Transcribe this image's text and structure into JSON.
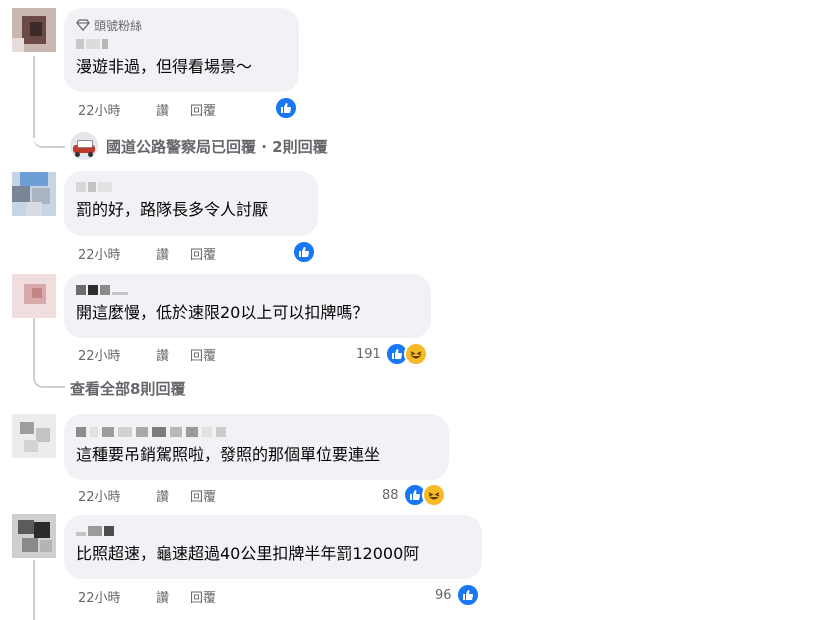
{
  "badges": {
    "top_fan": "頭號粉絲"
  },
  "actions": {
    "like": "讚",
    "reply": "回覆"
  },
  "comments": [
    {
      "text": "漫遊非過，但得看場景～",
      "time": "22小時",
      "reactions": {
        "count": "",
        "types": [
          "like"
        ]
      }
    },
    {
      "text": "罰的好，路隊長多令人討厭",
      "time": "22小時",
      "reactions": {
        "count": "",
        "types": [
          "like"
        ]
      }
    },
    {
      "text": "開這麼慢，低於速限20以上可以扣牌嗎？",
      "time": "22小時",
      "reactions": {
        "count": "191",
        "types": [
          "like",
          "haha"
        ]
      }
    },
    {
      "text": "這種要吊銷駕照啦，發照的那個單位要連坐",
      "time": "22小時",
      "reactions": {
        "count": "88",
        "types": [
          "like",
          "haha"
        ]
      }
    },
    {
      "text": "比照超速，龜速超過40公里扣牌半年罰12000阿",
      "time": "22小時",
      "reactions": {
        "count": "96",
        "types": [
          "like"
        ]
      }
    }
  ],
  "replies_summary": {
    "text": "國道公路警察局已回覆 · 2則回覆"
  },
  "view_all_replies": {
    "text": "查看全部8則回覆"
  },
  "icons": {
    "like": "like-icon",
    "haha": "haha-icon",
    "badge": "diamond-icon",
    "page_avatar": "police-car-icon"
  },
  "colors": {
    "like_blue": "#1877f2",
    "haha_yellow": "#f7b928",
    "bubble": "#f0f2f5",
    "meta_gray": "#65676b"
  }
}
